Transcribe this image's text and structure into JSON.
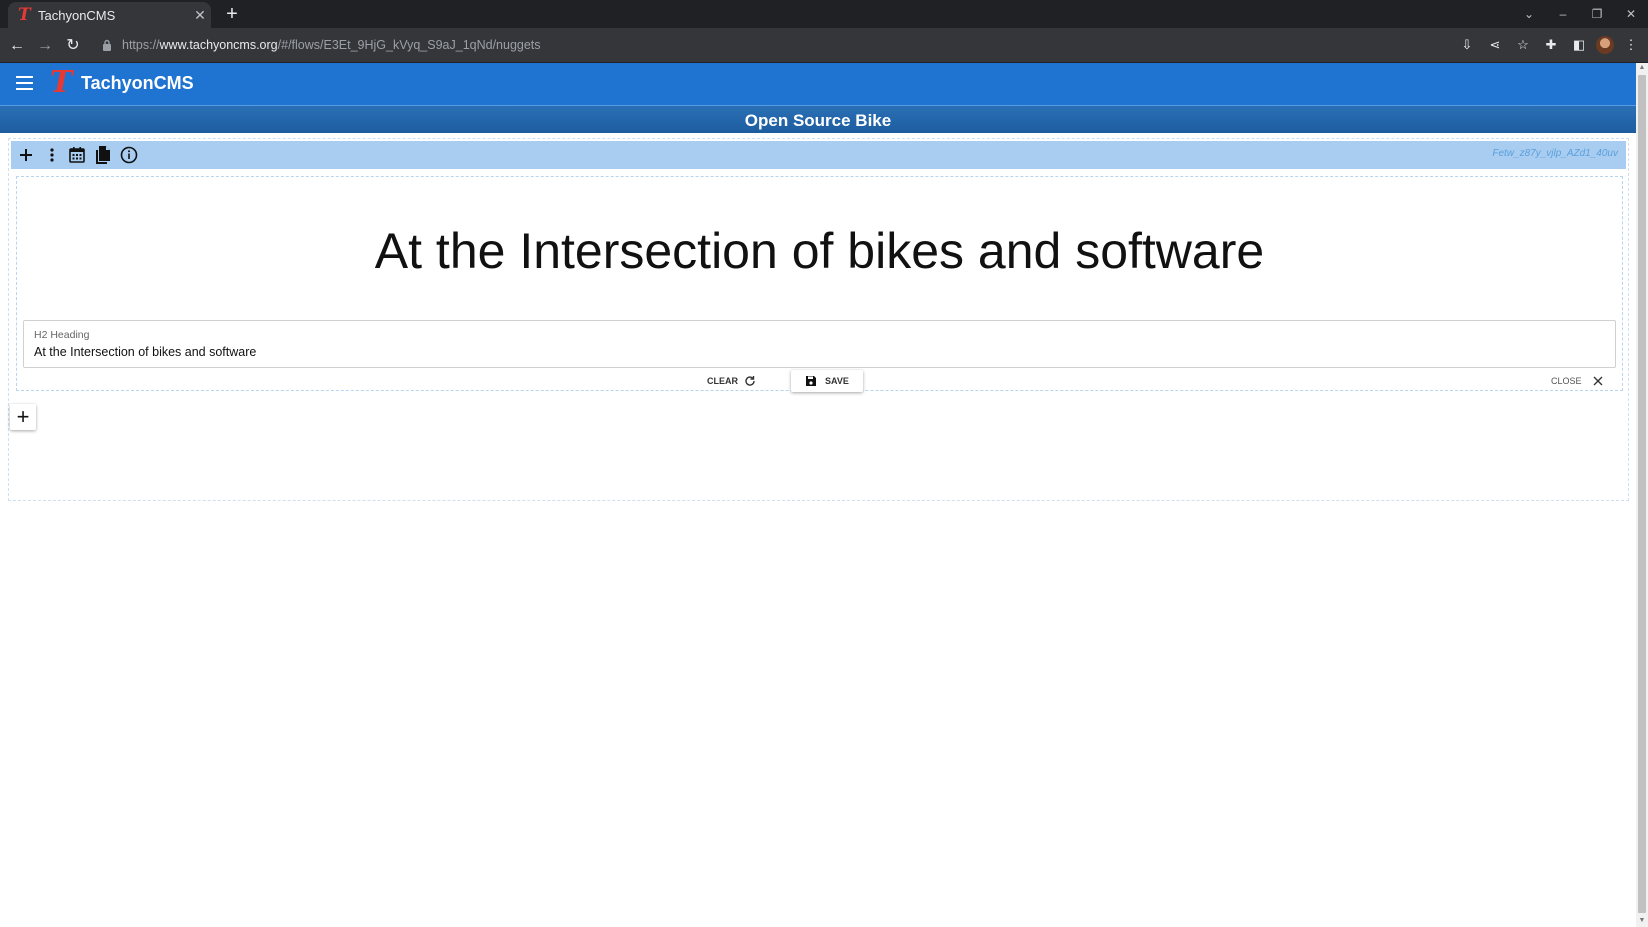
{
  "browser": {
    "tab_title": "TachyonCMS",
    "tab_favicon": "T",
    "url_scheme": "https://",
    "url_domain": "www.tachyoncms.org",
    "url_path": "/#/flows/E3Et_9HjG_kVyq_S9aJ_1qNd/nuggets"
  },
  "app": {
    "brand_logo": "T",
    "brand_title": "TachyonCMS",
    "flow_title": "Open Source Bike"
  },
  "flow": {
    "nugget_id": "Fetw_z87y_vjlp_AZd1_40uv"
  },
  "nugget": {
    "heading_text": "At the Intersection of bikes and software",
    "field_label": "H2 Heading",
    "field_value": "At the Intersection of bikes and software",
    "clear_label": "CLEAR",
    "save_label": "SAVE",
    "close_label": "CLOSE"
  },
  "colors": {
    "app_bar": "#1e74d0",
    "toolbar": "#a8cdf0",
    "brand_logo": "#e53935"
  }
}
